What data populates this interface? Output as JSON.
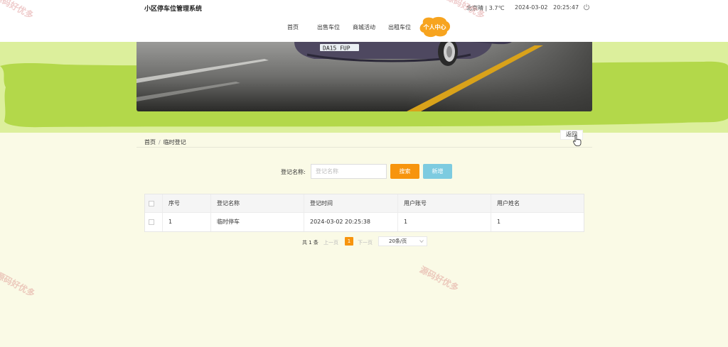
{
  "header": {
    "title": "小区停车位管理系统",
    "weather": "北京晴 | 3.7℃",
    "datetime": "2024-03-02   20:25:47",
    "power_icon": "power-icon"
  },
  "nav": {
    "items": [
      "首页",
      "出售车位",
      "商城活动",
      "出租车位"
    ],
    "active": "个人中心"
  },
  "banner": {
    "plate": "DA15 FUP"
  },
  "breadcrumb": {
    "home": "首页",
    "separator": "/",
    "current": "临时登记",
    "back": "返回"
  },
  "search": {
    "label": "登记名称:",
    "placeholder": "登记名称",
    "search_button": "搜索",
    "add_button": "新增"
  },
  "table": {
    "columns": [
      "序号",
      "登记名称",
      "登记时间",
      "用户账号",
      "用户姓名"
    ],
    "rows": [
      {
        "index": "1",
        "name": "临时停车",
        "time": "2024-03-02 20:25:38",
        "account": "1",
        "username": "1"
      }
    ]
  },
  "pagination": {
    "total": "共 1 条",
    "prev": "上一页",
    "current": "1",
    "next": "下一页",
    "page_size": "20条/页"
  },
  "watermark": "源码好优多",
  "colors": {
    "accent": "#f7940d",
    "banner_green": "#b3d84a",
    "light_green": "#dcef9c",
    "page_bg": "#fafae6",
    "add_button": "#7dcbe0"
  }
}
